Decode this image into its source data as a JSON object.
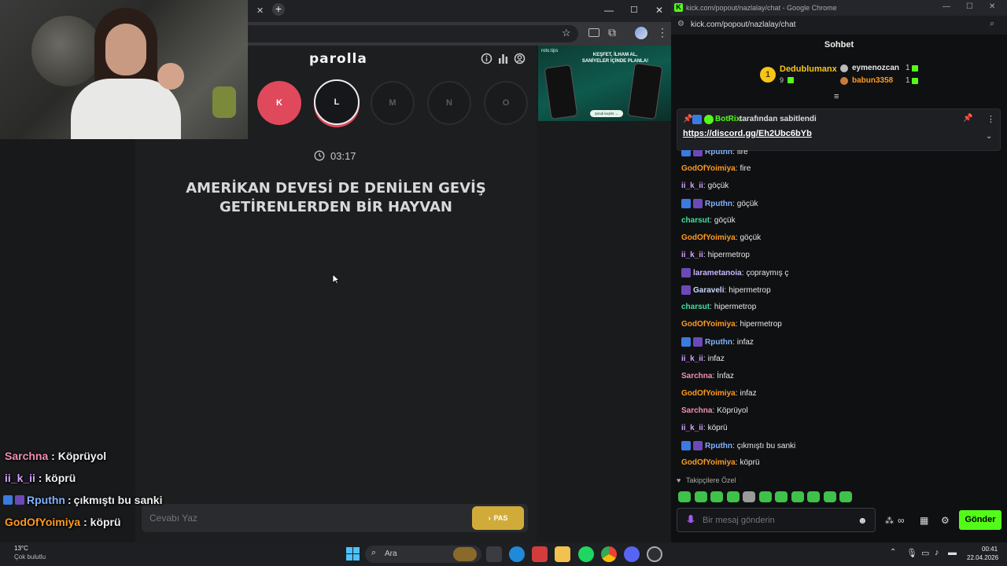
{
  "left_browser": {
    "window_controls": [
      "—",
      "☐",
      "✕"
    ]
  },
  "game": {
    "brand": "parolla",
    "letters": [
      {
        "char": "K",
        "state": "wrong"
      },
      {
        "char": "L",
        "state": "current"
      },
      {
        "char": "M",
        "state": "pending"
      },
      {
        "char": "N",
        "state": "pending"
      },
      {
        "char": "O",
        "state": "pending"
      }
    ],
    "timer": "03:17",
    "question_line1": "AMERİKAN DEVESİ DE DENİLEN GEVİŞ",
    "question_line2": "GETİRENLERDEN BİR HAYVAN",
    "answer_placeholder": "Cevabı Yaz",
    "pass_button": "PAS"
  },
  "ad": {
    "brand": "roto.tips",
    "headline_1": "KEŞFET, İLHAM AL,",
    "headline_2": "SANİYELER İÇİNDE PLANLA!",
    "cta": "Şimdi keşfet →"
  },
  "stream_overlay": [
    {
      "user": "Sarchna",
      "text": "Köprüyol",
      "color": "#f08fb3"
    },
    {
      "user": "ii_k_ii",
      "text": "köprü",
      "color": "#d4a0ff"
    },
    {
      "user": "Rputhn",
      "text": "çıkmıştı bu sanki",
      "color": "#7fb3ff",
      "badges": true
    },
    {
      "user": "GodOfYoimiya",
      "text": "köprü",
      "color": "#ff9a1f"
    }
  ],
  "chat_window": {
    "title": "kick.com/popout/nazlalay/chat - Google Chrome",
    "url": "kick.com/popout/nazlalay/chat",
    "header": "Sohbet",
    "leaderboard": [
      {
        "rank": "1",
        "name": "Dedublumanx",
        "count": "9",
        "color": "#f5c518"
      },
      {
        "name": "eymenozcan",
        "count": "1",
        "color": "#e8e8e8"
      },
      {
        "name": "babun3358",
        "count": "1",
        "color": "#ff9a1f"
      }
    ],
    "pinned_by": "BotRix",
    "pinned_suffix": "tarafından sabitlendi",
    "pinned_link": "https://discord.gg/Eh2Ubc6bYb",
    "messages": [
      {
        "user": "Rputhn",
        "text": "fire",
        "color": "#7fb3ff",
        "badges": true
      },
      {
        "user": "GodOfYoimiya",
        "text": "fire",
        "color": "#ff9a1f"
      },
      {
        "user": "ii_k_ii",
        "text": "göçük",
        "color": "#d4a0ff"
      },
      {
        "user": "Rputhn",
        "text": "göçük",
        "color": "#7fb3ff",
        "badges": true
      },
      {
        "user": "charsut",
        "text": "göçük",
        "color": "#41e0a0"
      },
      {
        "user": "GodOfYoimiya",
        "text": "göçük",
        "color": "#ff9a1f"
      },
      {
        "user": "ii_k_ii",
        "text": "hipermetrop",
        "color": "#d4a0ff"
      },
      {
        "user": "larametanoia",
        "text": "çopraymış ç",
        "color": "#c8b6ff",
        "star": true
      },
      {
        "user": "Garaveli",
        "text": "hipermetrop",
        "color": "#c8d8ff",
        "star": true
      },
      {
        "user": "charsut",
        "text": "hipermetrop",
        "color": "#41e0a0"
      },
      {
        "user": "GodOfYoimiya",
        "text": "hipermetrop",
        "color": "#ff9a1f"
      },
      {
        "user": "Rputhn",
        "text": "infaz",
        "color": "#7fb3ff",
        "badges": true
      },
      {
        "user": "ii_k_ii",
        "text": "infaz",
        "color": "#d4a0ff"
      },
      {
        "user": "Sarchna",
        "text": "İnfaz",
        "color": "#f08fb3"
      },
      {
        "user": "GodOfYoimiya",
        "text": "infaz",
        "color": "#ff9a1f"
      },
      {
        "user": "Sarchna",
        "text": "Köprüyol",
        "color": "#f08fb3"
      },
      {
        "user": "ii_k_ii",
        "text": "köprü",
        "color": "#d4a0ff"
      },
      {
        "user": "Rputhn",
        "text": "çıkmıştı bu sanki",
        "color": "#7fb3ff",
        "badges": true
      },
      {
        "user": "GodOfYoimiya",
        "text": "köprü",
        "color": "#ff9a1f"
      }
    ],
    "emote_label": "Takipçilere Özel",
    "input_placeholder": "Bir mesaj gönderin",
    "send_button": "Gönder",
    "accent": "#53fc18"
  },
  "taskbar": {
    "weather_temp": "13°C",
    "weather_desc": "Çok bulutlu",
    "search_label": "Ara",
    "time": "00:41",
    "date": "22.04.2026"
  }
}
